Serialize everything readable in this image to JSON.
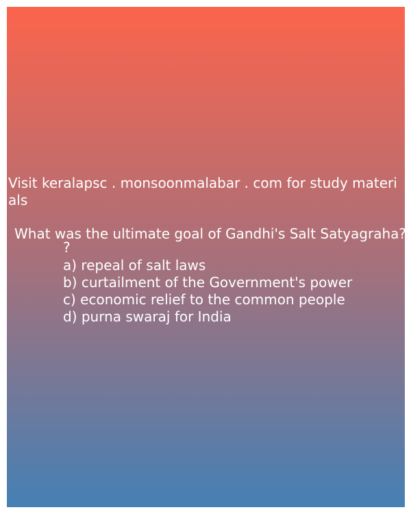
{
  "promo_text": "Visit keralapsc . monsoonmalabar . com for study materials",
  "question": "What was the ultimate goal of Gandhi's Salt Satyagraha?",
  "question_tail": "?",
  "options": [
    "a) repeal of salt laws",
    "b) curtailment of the Government's power",
    "c) economic relief to the common people",
    "d) purna swaraj for India"
  ],
  "colors": {
    "gradient_top": "#fc644c",
    "gradient_middle": "#a8707a",
    "gradient_bottom": "#4580b4",
    "text": "#ffffff"
  }
}
